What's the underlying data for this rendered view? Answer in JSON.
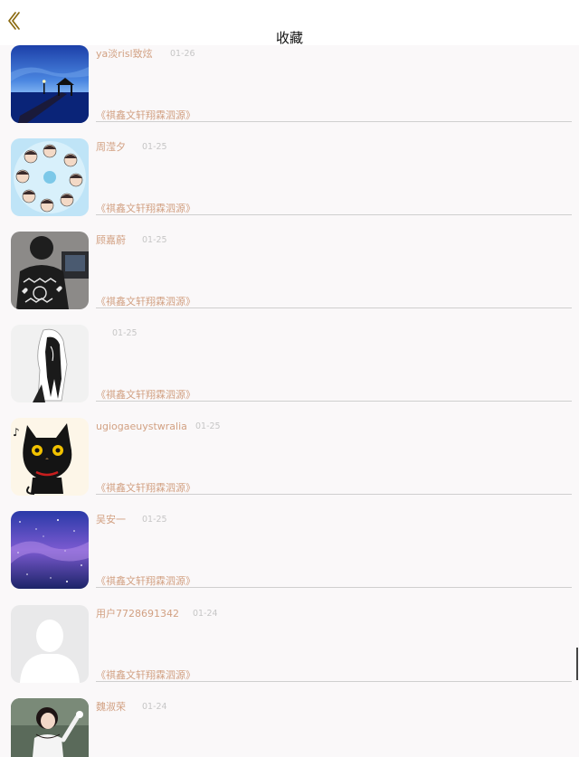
{
  "header": {
    "title": "收藏",
    "back_icon": "chevron-left-icon"
  },
  "favorites": [
    {
      "username": "ya淡risl致炫",
      "date": "01-26",
      "book": "《祺鑫文轩翔霖泗源》",
      "avatar": "blue-dusk-pavilion-photo"
    },
    {
      "username": "周滢夕",
      "date": "01-25",
      "book": "《祺鑫文轩翔霖泗源》",
      "avatar": "anime-circle-group-image"
    },
    {
      "username": "顾嘉蔚",
      "date": "01-25",
      "book": "《祺鑫文轩翔霖泗源》",
      "avatar": "person-in-patterned-sweater-photo"
    },
    {
      "username": "",
      "date": "01-25",
      "book": "《祺鑫文轩翔霖泗源》",
      "avatar": "sketch-girl-drawing"
    },
    {
      "username": "ugiogaeuystwralia",
      "date": "01-25",
      "book": "《祺鑫文轩翔霖泗源》",
      "avatar": "black-cat-cartoon"
    },
    {
      "username": "吴安一",
      "date": "01-25",
      "book": "《祺鑫文轩翔霖泗源》",
      "avatar": "starry-purple-sky-image"
    },
    {
      "username": "用户7728691342",
      "date": "01-24",
      "book": "《祺鑫文轩翔霖泗源》",
      "avatar": "default-avatar-silhouette"
    },
    {
      "username": "魏淑荣",
      "date": "01-24",
      "book": "",
      "avatar": "girl-in-white-dress-photo"
    }
  ],
  "colors": {
    "accent": "#d2a183",
    "back_icon": "#8a6a10",
    "date": "#c6c6c6",
    "background": "#faf8f9"
  }
}
